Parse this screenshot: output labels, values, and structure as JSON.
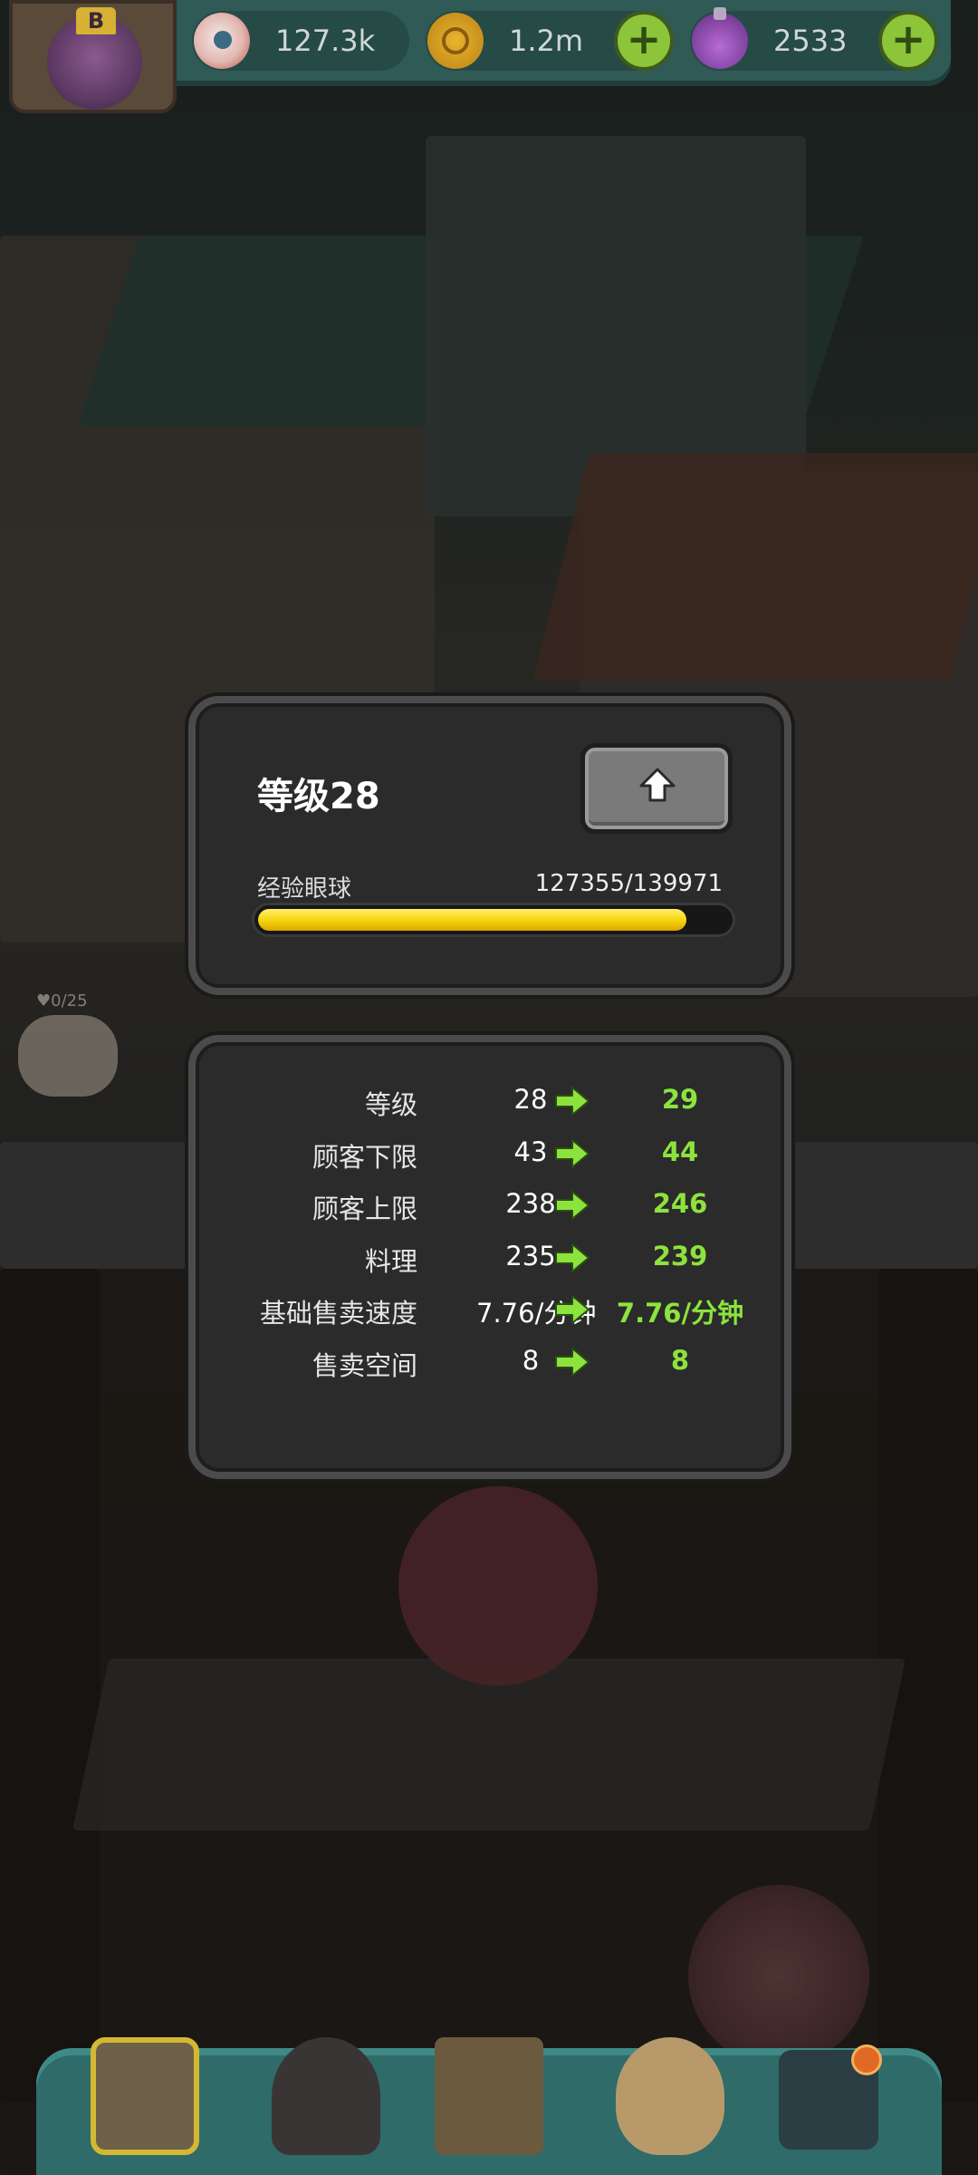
{
  "resources": {
    "eyeballs": "127.3k",
    "coins": "1.2m",
    "potions": "2533"
  },
  "avatar": {
    "badge": "B"
  },
  "level_panel": {
    "title": "等级28",
    "exp_label": "经验眼球",
    "exp_value": "127355/139971",
    "exp_progress": 0.9098
  },
  "stats": [
    {
      "name": "等级",
      "current": "28",
      "next": "29"
    },
    {
      "name": "顾客下限",
      "current": "43",
      "next": "44"
    },
    {
      "name": "顾客上限",
      "current": "238",
      "next": "246"
    },
    {
      "name": "料理",
      "current": "235",
      "next": "239"
    },
    {
      "name": "基础售卖速度",
      "current": "7.76/分钟",
      "next": "7.76/分钟"
    },
    {
      "name": "售卖空间",
      "current": "8",
      "next": "8"
    }
  ],
  "street": {
    "customer_count": "0/25"
  },
  "colors": {
    "accent_green": "#8de33e",
    "progress_yellow": "#f6d20c",
    "topbar_teal": "#2f5a55"
  },
  "icons": {
    "resource_1": "eyeball-icon",
    "resource_2": "coin-icon",
    "resource_3": "potion-icon",
    "upgrade": "up-arrow-icon",
    "stat_arrow": "right-arrow-icon"
  }
}
